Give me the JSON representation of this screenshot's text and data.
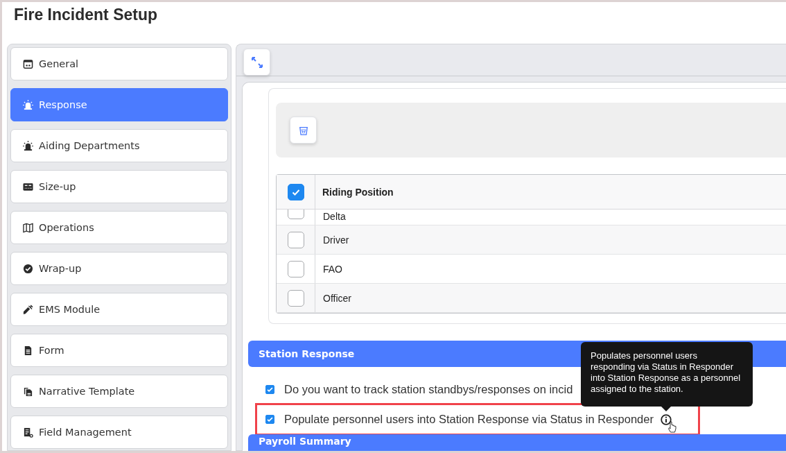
{
  "page": {
    "title": "Fire Incident Setup"
  },
  "sidebar": {
    "items": [
      {
        "label": "General",
        "selected": false,
        "kind": "calendar"
      },
      {
        "label": "Response",
        "selected": true,
        "kind": "siren"
      },
      {
        "label": "Aiding Departments",
        "selected": false,
        "kind": "siren"
      },
      {
        "label": "Size-up",
        "selected": false,
        "kind": "panel"
      },
      {
        "label": "Operations",
        "selected": false,
        "kind": "map"
      },
      {
        "label": "Wrap-up",
        "selected": false,
        "kind": "check"
      },
      {
        "label": "EMS Module",
        "selected": false,
        "kind": "syringe"
      },
      {
        "label": "Form",
        "selected": false,
        "kind": "file"
      },
      {
        "label": "Narrative Template",
        "selected": false,
        "kind": "copy"
      },
      {
        "label": "Field Management",
        "selected": false,
        "kind": "fields"
      }
    ]
  },
  "table": {
    "header_checked": true,
    "columns": [
      "Riding Position"
    ],
    "rows": [
      {
        "label": "Delta",
        "checked": false,
        "partial": true
      },
      {
        "label": "Driver",
        "checked": false,
        "partial": false
      },
      {
        "label": "FAO",
        "checked": false,
        "partial": false
      },
      {
        "label": "Officer",
        "checked": false,
        "partial": false
      }
    ]
  },
  "station_response": {
    "title": "Station Response",
    "options": [
      {
        "label": "Do you want to track station standbys/responses on incid",
        "checked": true,
        "highlighted": false,
        "info": false
      },
      {
        "label": "Populate personnel users into Station Response via Status in Responder",
        "checked": true,
        "highlighted": true,
        "info": true
      }
    ]
  },
  "tooltip": {
    "text": "Populates personnel users responding via Status in Responder into Station Response as a personnel assigned to the station."
  },
  "payroll": {
    "title": "Payroll Summary"
  }
}
